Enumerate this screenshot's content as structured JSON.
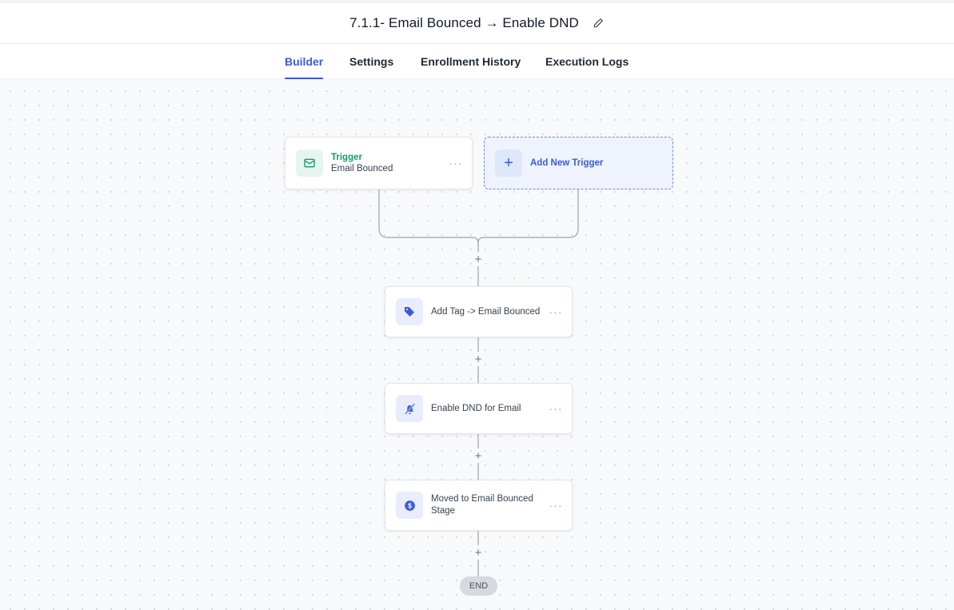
{
  "header": {
    "title": "7.1.1- Email Bounced → Enable DND",
    "edit_icon": "pencil-icon"
  },
  "tabs": [
    {
      "label": "Builder",
      "active": true
    },
    {
      "label": "Settings",
      "active": false
    },
    {
      "label": "Enrollment History",
      "active": false
    },
    {
      "label": "Execution Logs",
      "active": false
    }
  ],
  "trigger": {
    "title": "Trigger",
    "subtitle": "Email Bounced",
    "icon": "mail-icon",
    "menu": "···"
  },
  "add_trigger": {
    "label": "Add New Trigger",
    "plus": "+"
  },
  "actions": [
    {
      "label": "Add Tag -> Email Bounced",
      "icon": "tag-icon",
      "menu": "···"
    },
    {
      "label": "Enable DND for Email",
      "icon": "bell-off-icon",
      "menu": "···"
    },
    {
      "label": "Moved to Email Bounced Stage",
      "icon": "dollar-icon",
      "menu": "···"
    }
  ],
  "add_step": "+",
  "end_label": "END",
  "colors": {
    "accent": "#3b5bdb",
    "trigger_green": "#0f9d6b"
  }
}
